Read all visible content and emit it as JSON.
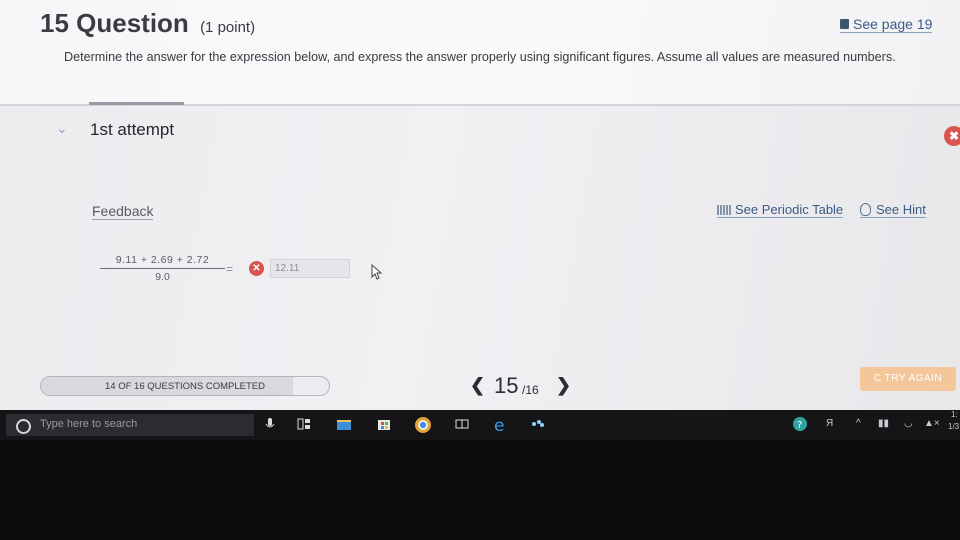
{
  "question": {
    "number_title": "15 Question",
    "points": "(1 point)",
    "see_page": "See page 19",
    "text": "Determine the answer for the expression below, and express the answer properly using significant figures. Assume all values are measured numbers."
  },
  "attempt": {
    "label": "1st attempt",
    "feedback_label": "Feedback",
    "periodic_table_label": "See Periodic Table",
    "hint_label": "See Hint"
  },
  "expression": {
    "numerator": "9.11 + 2.69 + 2.72",
    "denominator": "9.0",
    "equals": "=",
    "answer_value": "12.11"
  },
  "footer": {
    "progress_text": "14 OF 16 QUESTIONS COMPLETED",
    "progress_fraction": 0.875,
    "page_current": "15",
    "page_total": "/16",
    "try_again_label": "C TRY AGAIN"
  },
  "taskbar": {
    "search_placeholder": "Type here to search",
    "tray_time_short": "1:",
    "tray_date_short": "1/3"
  },
  "colors": {
    "link": "#3c5a86",
    "error": "#d9534f",
    "try_again": "#f3c79a"
  },
  "icons": [
    "book-icon",
    "chevron-down-icon",
    "close-icon",
    "periodic-table-icon",
    "lightbulb-icon",
    "error-x-icon",
    "mouse-cursor-icon",
    "search-icon"
  ]
}
